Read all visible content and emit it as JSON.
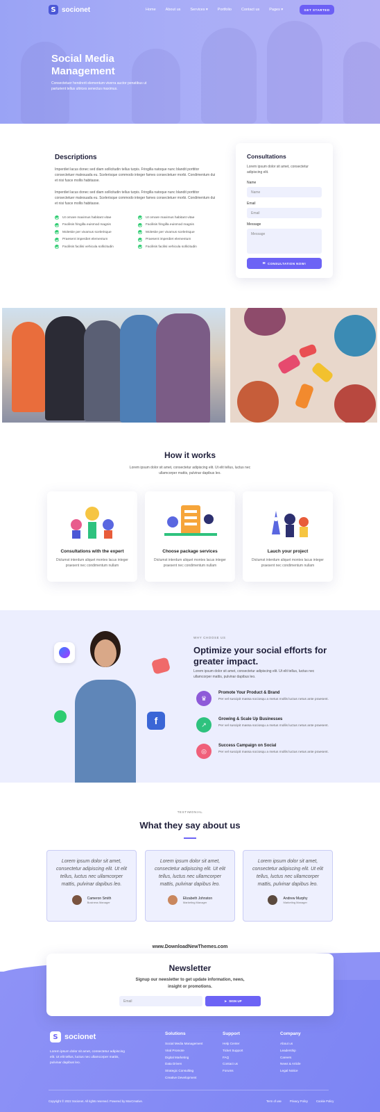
{
  "brand": {
    "name": "socionet"
  },
  "nav": {
    "items": [
      "Home",
      "About us",
      "Services",
      "Portfolio",
      "Contact us",
      "Pages"
    ],
    "cta": "GET STARTED"
  },
  "hero": {
    "title_line1": "Social Media",
    "title_line2": "Management",
    "subtitle_line1": "Consectetuer hendrerit elementum viverra auctor penatibus ut",
    "subtitle_line2": "parturient tellus ultrices senectus maximus."
  },
  "description": {
    "title": "Descriptions",
    "para1": "Imperdiet lacus donec sed diam sollicitudin tellus turpis. Fringilla natoque nunc blandit porttitor consectetuer malesuada eu. Scelerisque commodo integer fames consectetuer morbi. Condimentum dui et nisi fusce mollis habitasse.",
    "para2": "Imperdiet lacus donec sed diam sollicitudin tellus turpis. Fringilla natoque nunc blandit porttitor consectetuer malesuada eu. Scelerisque commodo integer fames consectetuer morbi. Condimentum dui et nisi fusce mollis habitasse.",
    "checks": [
      "Ut ornare maximus habitant vitae",
      "Ut ornare maximus habitant vitae",
      "Facilisis fringilla euismod magnis",
      "Facilisis fringilla euismod magnis",
      "Molestie per vivamus scelerisque",
      "Molestie per vivamus scelerisque",
      "Praesent imperdiet elementum",
      "Praesent imperdiet elementum",
      "Facilisis facilisi vehicula sollicitudin",
      "Facilisis facilisi vehicula sollicitudin"
    ]
  },
  "consult": {
    "title": "Consultations",
    "desc": "Lorem ipsum dolor sit amet, consectetur adipiscing elit.",
    "name_label": "Name",
    "name_ph": "Name",
    "email_label": "Email",
    "email_ph": "Email",
    "msg_label": "Message",
    "msg_ph": "Message",
    "button": "CONSULTATION NOW!"
  },
  "how": {
    "title": "How it works",
    "subtitle_line1": "Lorem ipsum dolor sit amet, consectetur adipiscing elit. Ut elit tellus, luctus nec",
    "subtitle_line2": "ullamcorper mattis, pulvinar dapibus leo.",
    "cards": [
      {
        "title": "Consultations with the expert",
        "text": "Dictumst interdum aliquet montes lacus integer praesent nec condimentum nullam"
      },
      {
        "title": "Choose package services",
        "text": "Dictumst interdum aliquet montes lacus integer praesent nec condimentum nullam"
      },
      {
        "title": "Lauch your project",
        "text": "Dictumst interdum aliquet montes lacus integer praesent nec condimentum nullam"
      }
    ]
  },
  "why": {
    "eyebrow": "WHY CHOOSE US",
    "title_line1": "Optimize your social efforts for",
    "title_line2": "greater impact.",
    "text": "Lorem ipsum dolor sit amet, consectetur adipiscing elit. Ut elit tellus, luctus nec ullamcorper mattis, pulvinar dapibus leo.",
    "features": [
      {
        "title": "Promote Your Product & Brand",
        "text": "Per vel suscipit massa sociosqu a metus mollis luctus netus ante praesent.",
        "color": "#8e5ad8"
      },
      {
        "title": "Growing & Scale Up Businesses",
        "text": "Per vel suscipit massa sociosqu a metus mollis luctus netus ante praesent.",
        "color": "#2ec27e"
      },
      {
        "title": "Success Campaign on Social",
        "text": "Per vel suscipit massa sociosqu a metus mollis luctus netus ante praesent.",
        "color": "#f0607a"
      }
    ]
  },
  "testimonials": {
    "eyebrow": "TESTIMONIAL",
    "title": "What they say about us",
    "quote": "Lorem ipsum dolor sit amet, consectetur adipiscing elit. Ut elit tellus, luctus nec ullamcorper mattis, pulvinar dapibus leo.",
    "people": [
      {
        "name": "Cameron Smith",
        "role": "Business Manager"
      },
      {
        "name": "Elizabeth Johnston",
        "role": "Marketing Manager"
      },
      {
        "name": "Andrew Murphy",
        "role": "Marketing Manager"
      }
    ]
  },
  "watermark": "www.DownloadNewThemes.com",
  "newsletter": {
    "title": "Newsletter",
    "subtitle_line1": "Signup our newsletter to get update information, news,",
    "subtitle_line2": "insight or promotions.",
    "email_ph": "Email",
    "button": "SIGN UP"
  },
  "footer": {
    "about": "Lorem ipsum dolor sit amet, consectetur adipiscing elit. Ut elit tellus, luctus nec ullamcorper mattis, pulvinar dapibus leo.",
    "solutions_title": "Solutions",
    "solutions": [
      "Social Media Management",
      "Viral Promote",
      "Digital Marketing",
      "Data Driven",
      "Strategic Consulting",
      "Creative Development"
    ],
    "support_title": "Support",
    "support": [
      "Help Center",
      "Ticket Support",
      "FAQ",
      "Contact us",
      "Forums"
    ],
    "company_title": "Company",
    "company": [
      "About us",
      "Leadership",
      "Careers",
      "News & Article",
      "Legal Notice"
    ],
    "copyright": "Copyright © 2022 Socionet. All rights reserved. Powered by MoxCreative.",
    "legal": [
      "Term of use",
      "Privacy Policy",
      "Cookie Policy"
    ]
  }
}
